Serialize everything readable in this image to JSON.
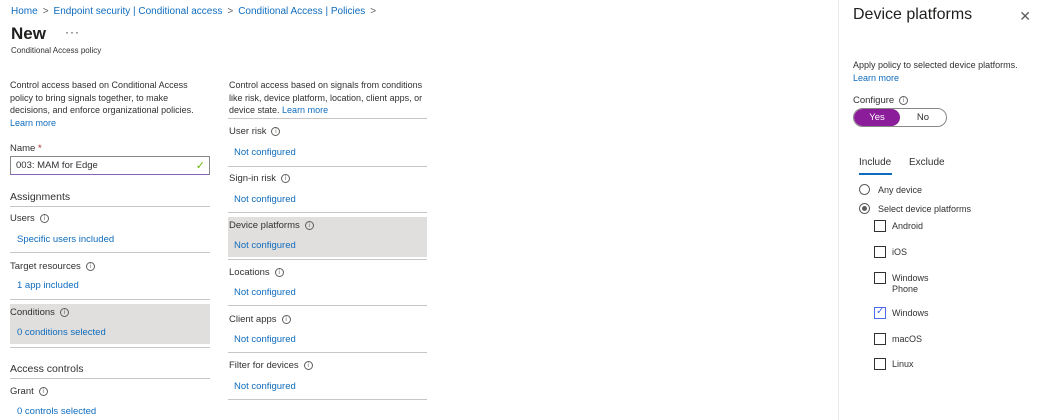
{
  "breadcrumb": [
    "Home",
    "Endpoint security | Conditional access",
    "Conditional Access | Policies"
  ],
  "page": {
    "title": "New",
    "more": "···",
    "subtitle": "Conditional Access policy"
  },
  "left": {
    "description": "Control access based on Conditional Access policy to bring signals together, to make decisions, and enforce organizational policies.",
    "learn_more": "Learn more",
    "name_label": "Name",
    "name_required": "*",
    "name_value": "003: MAM for Edge",
    "assignments_heading": "Assignments",
    "users_label": "Users",
    "users_value": "Specific users included",
    "target_label": "Target resources",
    "target_value": "1 app included",
    "conditions_label": "Conditions",
    "conditions_value": "0 conditions selected",
    "access_heading": "Access controls",
    "grant_label": "Grant",
    "grant_value": "0 controls selected"
  },
  "middle": {
    "description": "Control access based on signals from conditions like risk, device platform, location, client apps, or device state.",
    "learn_more": "Learn more",
    "items": [
      {
        "label": "User risk",
        "value": "Not configured"
      },
      {
        "label": "Sign-in risk",
        "value": "Not configured"
      },
      {
        "label": "Device platforms",
        "value": "Not configured"
      },
      {
        "label": "Locations",
        "value": "Not configured"
      },
      {
        "label": "Client apps",
        "value": "Not configured"
      },
      {
        "label": "Filter for devices",
        "value": "Not configured"
      }
    ]
  },
  "panel": {
    "title": "Device platforms",
    "close": "✕",
    "description": "Apply policy to selected device platforms.",
    "learn_more": "Learn more",
    "configure_label": "Configure",
    "toggle_yes": "Yes",
    "toggle_no": "No",
    "tabs": [
      "Include",
      "Exclude"
    ],
    "radios": [
      {
        "label": "Any device",
        "checked": false
      },
      {
        "label": "Select device platforms",
        "checked": true
      }
    ],
    "platforms": [
      {
        "label": "Android",
        "checked": false
      },
      {
        "label": "iOS",
        "checked": false
      },
      {
        "label": "Windows Phone",
        "checked": false
      },
      {
        "label": "Windows",
        "checked": true
      },
      {
        "label": "macOS",
        "checked": false
      },
      {
        "label": "Linux",
        "checked": false
      }
    ]
  },
  "colors": {
    "accent": "#0f6cbd",
    "toggle_on": "#8c1d9a",
    "highlight": "#e1dfdd"
  }
}
